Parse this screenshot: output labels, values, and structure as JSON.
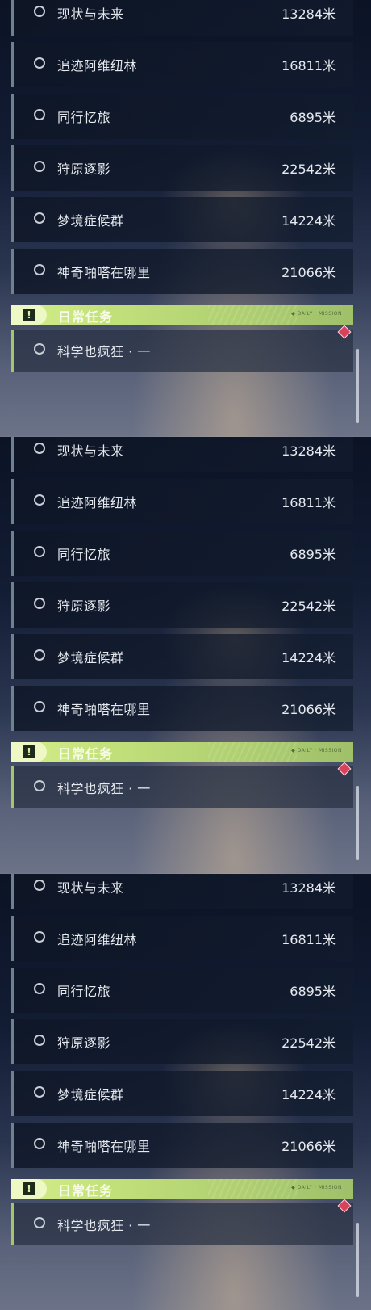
{
  "panels": [
    {
      "quests": [
        {
          "name": "现状与未来",
          "distance": "13284米"
        },
        {
          "name": "追迹阿维纽林",
          "distance": "16811米"
        },
        {
          "name": "同行忆旅",
          "distance": "6895米"
        },
        {
          "name": "狩原逐影",
          "distance": "22542米"
        },
        {
          "name": "梦境症候群",
          "distance": "14224米"
        },
        {
          "name": "神奇啪嗒在哪里",
          "distance": "21066米"
        }
      ],
      "daily": {
        "icon": "!",
        "title": "日常任务",
        "tag": "◆ DAILY · MISSION",
        "quest": "科学也疯狂 · 一"
      }
    },
    {
      "quests": [
        {
          "name": "现状与未来",
          "distance": "13284米"
        },
        {
          "name": "追迹阿维纽林",
          "distance": "16811米"
        },
        {
          "name": "同行忆旅",
          "distance": "6895米"
        },
        {
          "name": "狩原逐影",
          "distance": "22542米"
        },
        {
          "name": "梦境症候群",
          "distance": "14224米"
        },
        {
          "name": "神奇啪嗒在哪里",
          "distance": "21066米"
        }
      ],
      "daily": {
        "icon": "!",
        "title": "日常任务",
        "tag": "◆ DAILY · MISSION",
        "quest": "科学也疯狂 · 一"
      }
    },
    {
      "quests": [
        {
          "name": "现状与未来",
          "distance": "13284米"
        },
        {
          "name": "追迹阿维纽林",
          "distance": "16811米"
        },
        {
          "name": "同行忆旅",
          "distance": "6895米"
        },
        {
          "name": "狩原逐影",
          "distance": "22542米"
        },
        {
          "name": "梦境症候群",
          "distance": "14224米"
        },
        {
          "name": "神奇啪嗒在哪里",
          "distance": "21066米"
        }
      ],
      "daily": {
        "icon": "!",
        "title": "日常任务",
        "tag": "◆ DAILY · MISSION",
        "quest": "科学也疯狂 · 一"
      }
    }
  ],
  "colors": {
    "daily_accent": "#c2e07a",
    "quest_border": "#6d8190",
    "marker": "#d8425a"
  }
}
